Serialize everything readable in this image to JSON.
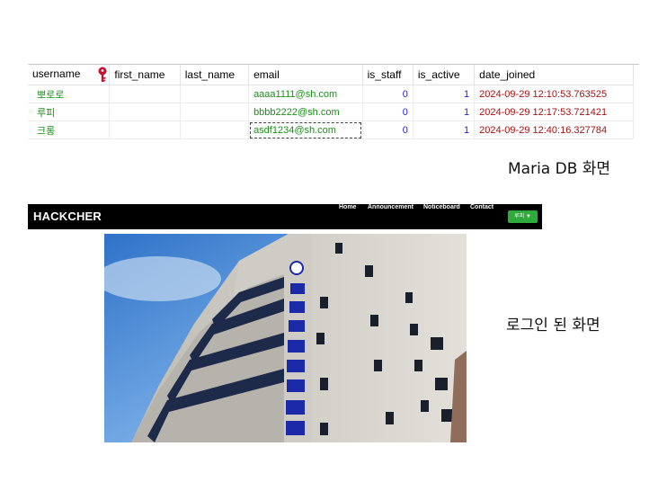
{
  "db": {
    "columns": [
      "username",
      "first_name",
      "last_name",
      "email",
      "is_staff",
      "is_active",
      "date_joined"
    ],
    "rows": [
      {
        "username": "뽀로로",
        "first_name": "",
        "last_name": "",
        "email": "aaaa1111@sh.com",
        "is_staff": "0",
        "is_active": "1",
        "date_joined": "2024-09-29 12:10:53.763525"
      },
      {
        "username": "루피",
        "first_name": "",
        "last_name": "",
        "email": "bbbb2222@sh.com",
        "is_staff": "0",
        "is_active": "1",
        "date_joined": "2024-09-29 12:17:53.721421"
      },
      {
        "username": "크롱",
        "first_name": "",
        "last_name": "",
        "email": "asdf1234@sh.com",
        "is_staff": "0",
        "is_active": "1",
        "date_joined": "2024-09-29 12:40:16.327784"
      }
    ]
  },
  "captions": {
    "db": "Maria DB 화면",
    "login": "로그인 된 화면"
  },
  "site": {
    "brand": "HACKCHER",
    "nav": [
      "Home",
      "Announcement",
      "Noticeboard",
      "Contact"
    ],
    "user_button": "루피 ▼"
  },
  "colors": {
    "navbar_bg": "#000000",
    "user_button_bg": "#2eab3a",
    "username_text": "#1a8f1a",
    "number_text": "#1f1fd0",
    "date_text": "#a01414"
  },
  "icons": {
    "key": "primary-key-icon"
  }
}
